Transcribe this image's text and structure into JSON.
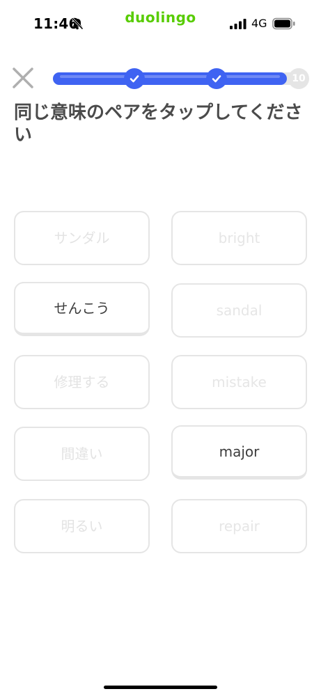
{
  "status_bar": {
    "time": "11:46",
    "network": "4G",
    "icons": [
      "bell-off-icon",
      "signal-bars-icon",
      "battery-icon"
    ]
  },
  "app": {
    "brand": "duolingo",
    "brand_color": "#58cc02"
  },
  "lesson": {
    "close_icon": "close-icon",
    "progress": {
      "fraction": 0.92,
      "checkpoints_completed": 2,
      "goal_label": "10",
      "fill_color": "#3f63f2",
      "track_color": "#e5e5e5",
      "checkpoint_icon": "check-icon"
    },
    "instruction": "同じ意味のペアをタップしてください"
  },
  "match_tiles": {
    "left": [
      {
        "label": "サンダル",
        "state": "matched"
      },
      {
        "label": "せんこう",
        "state": "available"
      },
      {
        "label": "修理する",
        "state": "matched"
      },
      {
        "label": "間違い",
        "state": "matched"
      },
      {
        "label": "明るい",
        "state": "matched"
      }
    ],
    "right": [
      {
        "label": "bright",
        "state": "matched"
      },
      {
        "label": "sandal",
        "state": "matched"
      },
      {
        "label": "mistake",
        "state": "matched"
      },
      {
        "label": "major",
        "state": "available"
      },
      {
        "label": "repair",
        "state": "matched"
      }
    ]
  }
}
